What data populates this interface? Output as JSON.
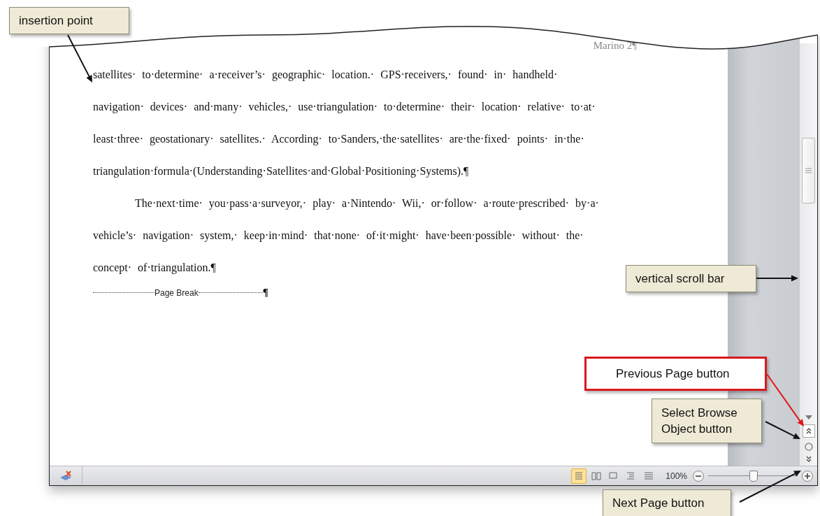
{
  "callouts": [
    {
      "text": "insertion point",
      "kind": "note"
    },
    {
      "text": "vertical scroll bar",
      "kind": "note"
    },
    {
      "text": "Previous Page button",
      "kind": "highlight"
    },
    {
      "text": "Select Browse Object button",
      "kind": "note"
    },
    {
      "text": "Next Page button",
      "kind": "note"
    }
  ],
  "document": {
    "header": "Marino 2¶",
    "lines": [
      {
        "text": "satellites· to·determine· a·receiver’s· geographic· location.· GPS·receivers,· found· in· handheld·",
        "indent": false
      },
      {
        "text": "navigation· devices· and·many· vehicles,· use·triangulation· to·determine· their· location· relative· to·at·",
        "indent": false
      },
      {
        "text": "least·three· geostationary· satellites.· According· to·Sanders,·the·satellites· are·the·fixed· points· in·the·",
        "indent": false
      },
      {
        "text": "triangulation·formula·(Understanding·Satellites·and·Global·Positioning·Systems).¶",
        "indent": false
      },
      {
        "text": "The·next·time· you·pass·a·surveyor,· play· a·Nintendo· Wii,· or·follow· a·route·prescribed· by·a·",
        "indent": true
      },
      {
        "text": "vehicle’s· navigation· system,· keep·in·mind· that·none· of·it·might· have·been·possible· without· the·",
        "indent": false
      },
      {
        "text": "concept· of·triangulation.¶",
        "indent": false
      }
    ],
    "page_break": {
      "label": "Page Break",
      "mark": "¶"
    }
  },
  "status_bar": {
    "view_buttons": [
      {
        "selected": true
      },
      {
        "selected": false
      },
      {
        "selected": false
      },
      {
        "selected": false
      },
      {
        "selected": false
      }
    ],
    "zoom_label": "100%",
    "zoom_slider": {
      "level": 0.5
    }
  }
}
